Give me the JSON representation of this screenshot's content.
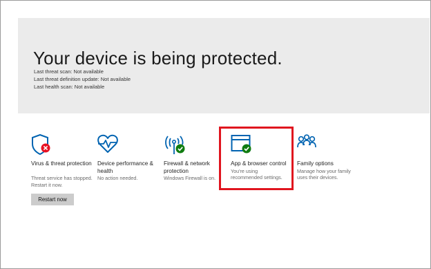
{
  "hero": {
    "title": "Your device is being protected.",
    "scans": [
      "Last threat scan: Not available",
      "Last threat definition update: Not available",
      "Last health scan: Not available"
    ]
  },
  "tiles": [
    {
      "icon": "shield-error-icon",
      "title": "Virus & threat protection",
      "status": [
        "Threat service has stopped.",
        "Restart it now."
      ],
      "action": "Restart now"
    },
    {
      "icon": "heart-pulse-icon",
      "title": "Device performance & health",
      "status": [
        "No action needed."
      ]
    },
    {
      "icon": "antenna-check-icon",
      "title": "Firewall & network protection",
      "status": [
        "Windows Firewall is on."
      ]
    },
    {
      "icon": "browser-check-icon",
      "title": "App & browser control",
      "status": [
        "You're using",
        "recommended settings."
      ]
    },
    {
      "icon": "family-icon",
      "title": "Family options",
      "status": [
        "Manage how your family",
        "uses their devices."
      ]
    }
  ],
  "colors": {
    "accent": "#0063b1",
    "ok": "#107c10",
    "error": "#e81123",
    "highlight": "#e0141e"
  }
}
